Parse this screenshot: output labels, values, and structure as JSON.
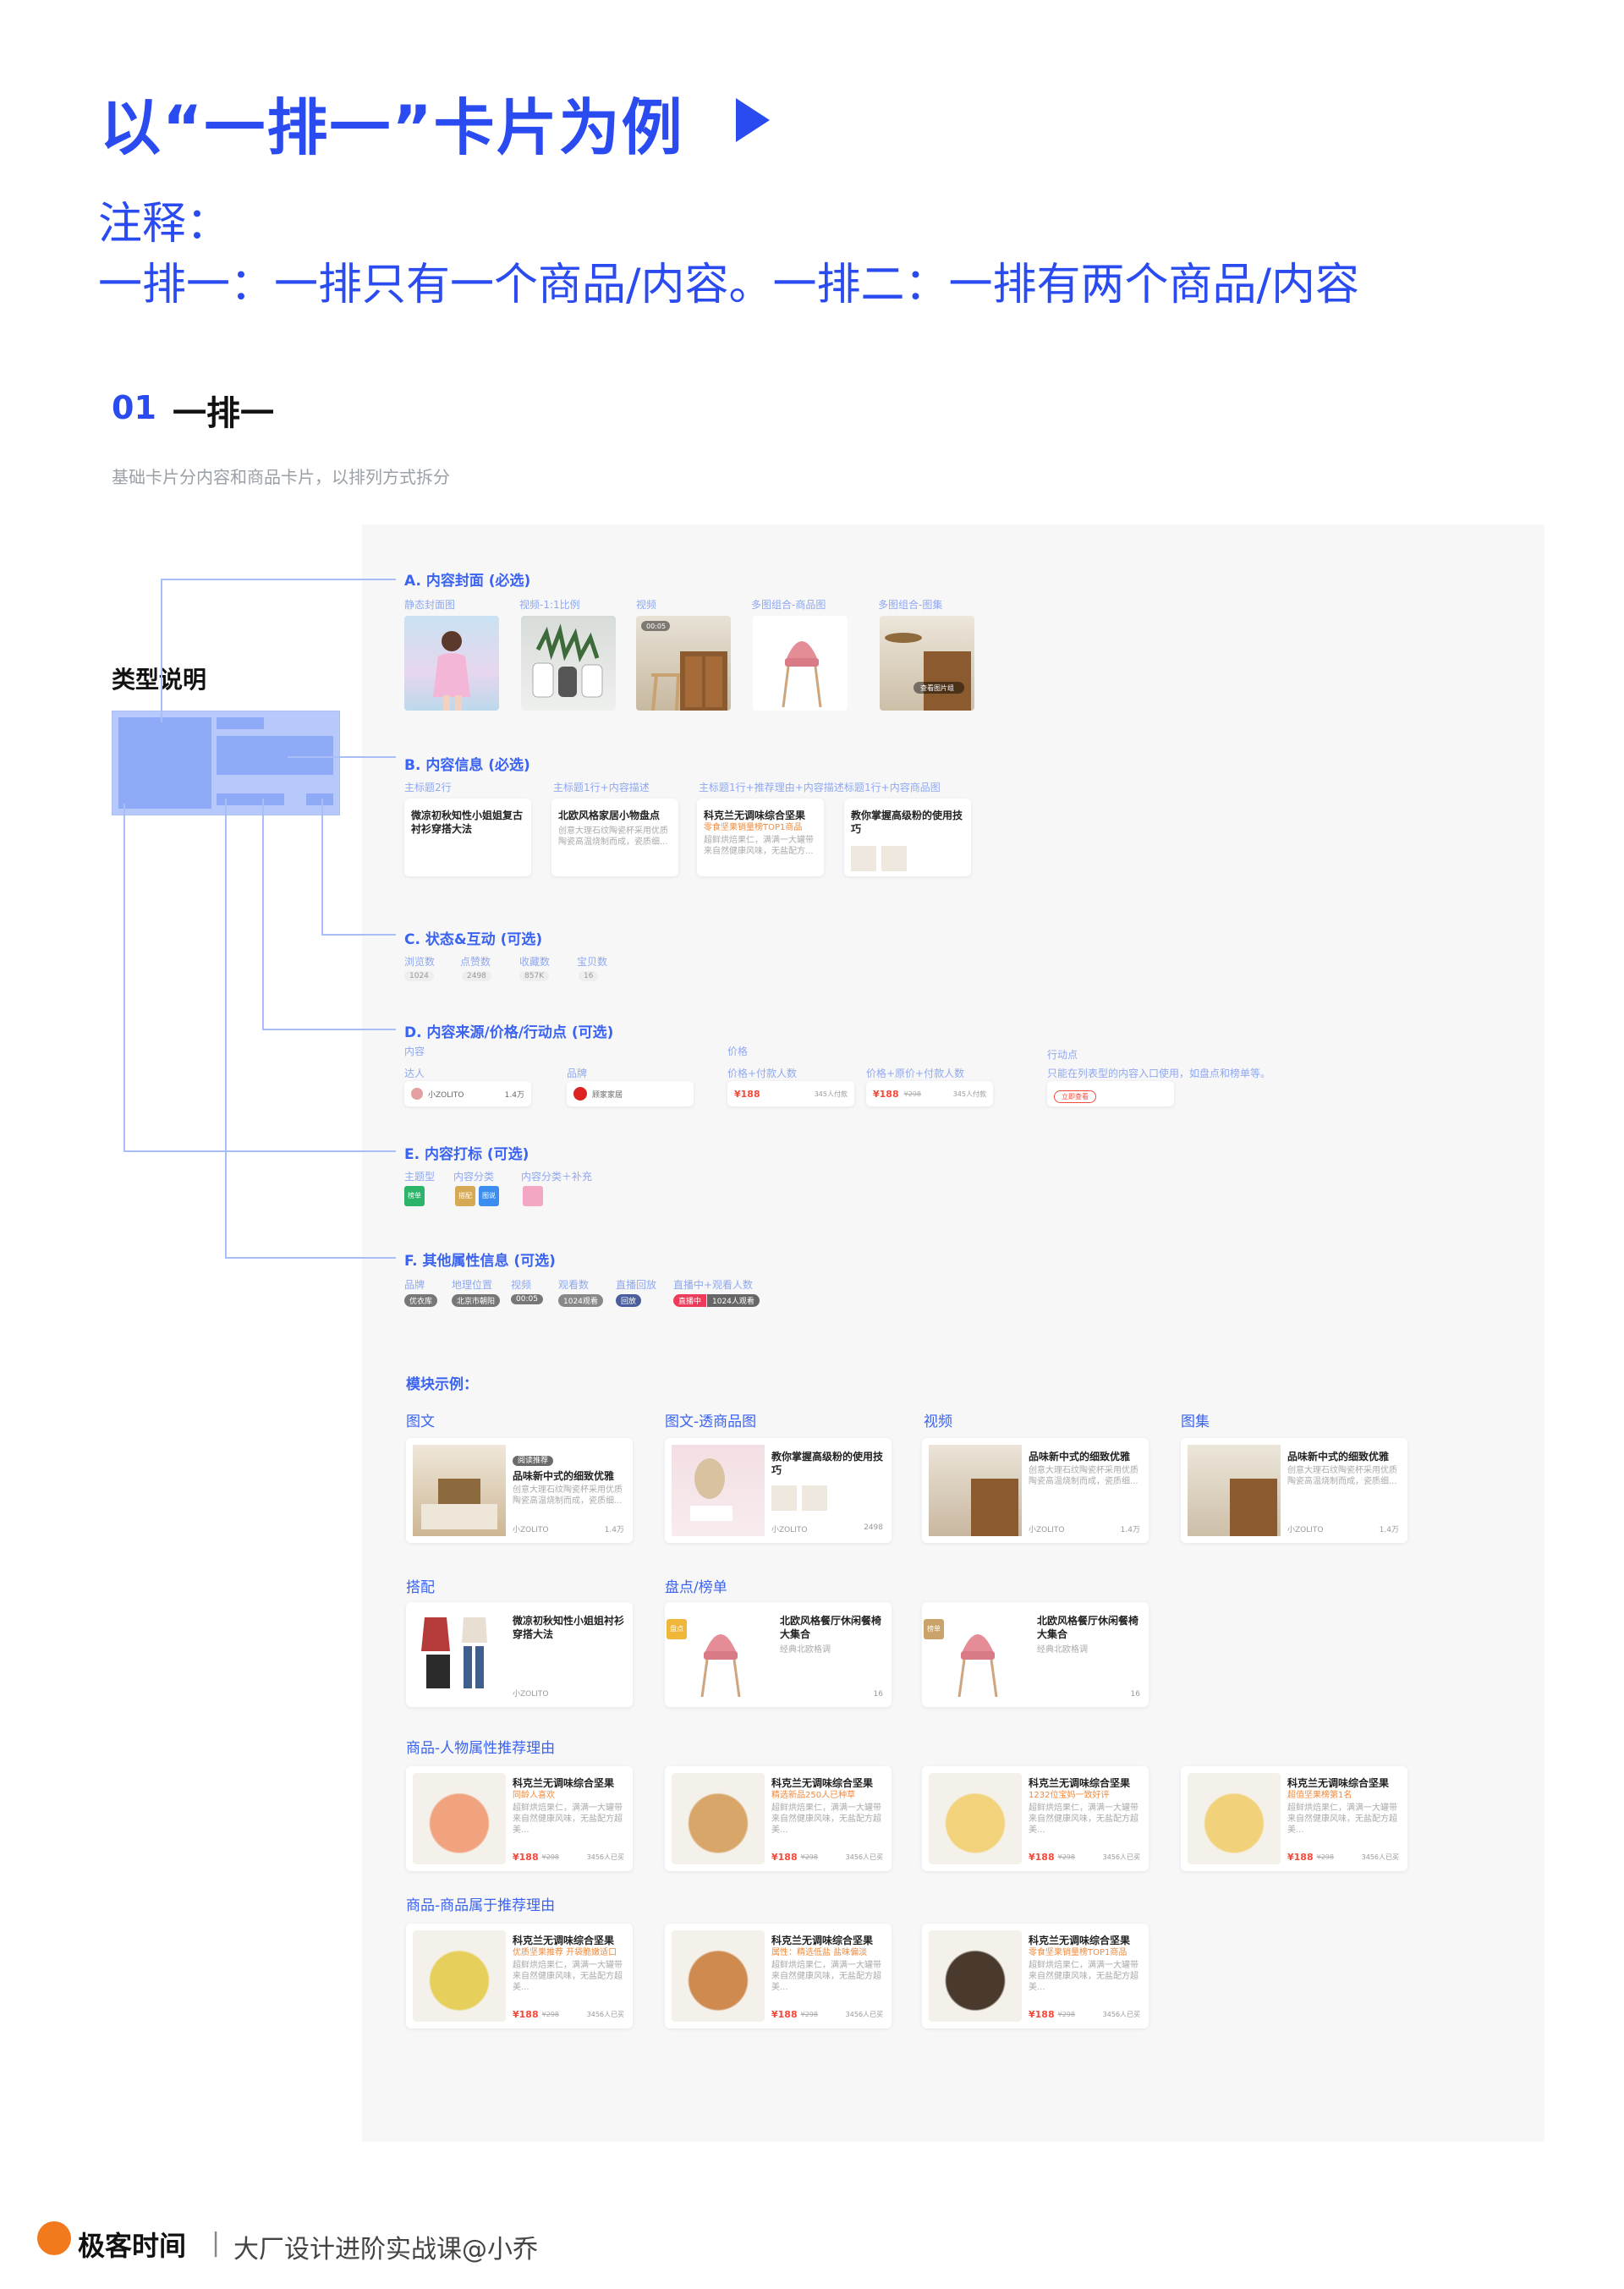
{
  "title": "以“一排一”卡片为例",
  "note_line1": "注释：",
  "note_line2": "一排一：一排只有一个商品/内容。一排二：一排有两个商品/内容",
  "section": {
    "num": "01",
    "title": "一排一",
    "desc": "基础卡片分内容和商品卡片，以排列方式拆分"
  },
  "type_label": "类型说明",
  "A": {
    "heading": "A. 内容封面 (必选)",
    "captions": [
      "静态封面图",
      "视频-1:1比例",
      "视频",
      "多图组合-商品图",
      "多图组合-图集"
    ],
    "badge": "查看图片组",
    "time": "00:05"
  },
  "B": {
    "heading": "B. 内容信息 (必选)",
    "captions": [
      "主标题2行",
      "主标题1行+内容描述",
      "主标题1行+推荐理由+内容描述",
      "标题1行+内容商品图"
    ],
    "cards": [
      {
        "title": "微凉初秋知性小姐姐复古衬衫穿搭大法",
        "desc": ""
      },
      {
        "title": "北欧风格家居小物盘点",
        "desc": "创意大理石纹陶瓷杯采用优质陶瓷高温烧制而成，瓷质细..."
      },
      {
        "title": "科克兰无调味综合坚果",
        "reason": "零食坚果销量榜TOP1商品",
        "desc": "超鲜烘焙果仁，满满一大罐带来自然健康风味，无盐配方..."
      },
      {
        "title": "教你掌握高级粉的使用技巧",
        "desc": ""
      }
    ]
  },
  "C": {
    "heading": "C. 状态&互动 (可选)",
    "captions": [
      "浏览数",
      "点赞数",
      "收藏数",
      "宝贝数"
    ],
    "values": [
      "1024",
      "2498",
      "857K",
      "16"
    ]
  },
  "D": {
    "heading": "D. 内容来源/价格/行动点 (可选)",
    "col1": "内容",
    "col2": "价格",
    "col3": "行动点",
    "captions": [
      "达人",
      "品牌",
      "价格+付款人数",
      "价格+原价+付款人数"
    ],
    "note": "只能在列表型的内容入口使用，如盘点和榜单等。",
    "author": "小ZOLITO",
    "views": "1.4万",
    "brand": "顾家家居",
    "price": "¥188",
    "orig": "¥298",
    "paid": "345人付款",
    "action": "立即查看"
  },
  "E": {
    "heading": "E. 内容打标 (可选)",
    "captions": [
      "主题型",
      "内容分类",
      "内容分类＋补充"
    ],
    "tags": [
      "榜单",
      "搭配",
      "图说",
      ""
    ]
  },
  "F": {
    "heading": "F. 其他属性信息 (可选)",
    "captions": [
      "品牌",
      "地理位置",
      "视频",
      "观看数",
      "直播回放",
      "直播中+观看人数"
    ],
    "chips": [
      "优衣库",
      "北京市朝阳",
      "00:05",
      "1024观看",
      "回放",
      "直播中",
      "1024人观看"
    ]
  },
  "modules": {
    "heading": "模块示例：",
    "row1": [
      {
        "label": "图文",
        "badge": "阅读推荐",
        "title": "品味新中式的细致优雅",
        "desc": "创意大理石纹陶瓷杯采用优质陶瓷高温烧制而成，瓷质细...",
        "author": "小ZOLITO",
        "stat": "1.4万"
      },
      {
        "label": "图文-透商品图",
        "title": "教你掌握高级粉的使用技巧",
        "author": "小ZOLITO",
        "stat": "2498"
      },
      {
        "label": "视频",
        "title": "品味新中式的细致优雅",
        "desc": "创意大理石纹陶瓷杯采用优质陶瓷高温烧制而成，瓷质细...",
        "author": "小ZOLITO",
        "stat": "1.4万"
      },
      {
        "label": "图集",
        "title": "品味新中式的细致优雅",
        "desc": "创意大理石纹陶瓷杯采用优质陶瓷高温烧制而成，瓷质细...",
        "author": "小ZOLITO",
        "stat": "1.4万"
      }
    ],
    "row2": [
      {
        "label": "搭配",
        "title": "微凉初秋知性小姐姐衬衫穿搭大法",
        "author": "小ZOLITO"
      },
      {
        "label": "盘点/榜单",
        "tag": "盘点",
        "title": "北欧风格餐厅休闲餐椅大集合",
        "desc": "经典北欧格调",
        "stat": "16"
      },
      {
        "label": "",
        "tag": "榜单",
        "title": "北欧风格餐厅休闲餐椅大集合",
        "desc": "经典北欧格调",
        "stat": "16"
      }
    ],
    "row3_label": "商品-人物属性推荐理由",
    "row3": [
      {
        "title": "科克兰无调味综合坚果",
        "reason": "同龄人喜欢",
        "desc": "超鲜烘焙果仁，满满一大罐带来自然健康风味，无盐配方超美...",
        "price": "¥188",
        "orig": "¥298",
        "paid": "3456人已买"
      },
      {
        "title": "科克兰无调味综合坚果",
        "reason": "精选新品250人已种草",
        "desc": "超鲜烘焙果仁，满满一大罐带来自然健康风味，无盐配方超美...",
        "price": "¥188",
        "orig": "¥298",
        "paid": "3456人已买"
      },
      {
        "title": "科克兰无调味综合坚果",
        "reason": "1232位宝妈一致好评",
        "desc": "超鲜烘焙果仁，满满一大罐带来自然健康风味，无盐配方超美...",
        "price": "¥188",
        "orig": "¥298",
        "paid": "3456人已买"
      },
      {
        "title": "科克兰无调味综合坚果",
        "reason": "超值坚果榜第1名",
        "desc": "超鲜烘焙果仁，满满一大罐带来自然健康风味，无盐配方超美...",
        "price": "¥188",
        "orig": "¥298",
        "paid": "3456人已买"
      }
    ],
    "row4_label": "商品-商品属于推荐理由",
    "row4": [
      {
        "title": "科克兰无调味综合坚果",
        "reason": "优质坚果推荐 开袋脆嫩适口",
        "desc": "超鲜烘焙果仁，满满一大罐带来自然健康风味，无盐配方超美...",
        "price": "¥188",
        "orig": "¥298",
        "paid": "3456人已买"
      },
      {
        "title": "科克兰无调味综合坚果",
        "reason": "属性：精选低盐 盐味偏淡",
        "desc": "超鲜烘焙果仁，满满一大罐带来自然健康风味，无盐配方超美...",
        "price": "¥188",
        "orig": "¥298",
        "paid": "3456人已买"
      },
      {
        "title": "科克兰无调味综合坚果",
        "reason": "零食坚果销量榜TOP1商品",
        "desc": "超鲜烘焙果仁，满满一大罐带来自然健康风味，无盐配方超美...",
        "price": "¥188",
        "orig": "¥298",
        "paid": "3456人已买"
      }
    ]
  },
  "footer": {
    "brand": "极客时间",
    "sep": "|",
    "text": "大厂设计进阶实战课@小乔"
  },
  "colors": {
    "accent": "#2a4bf0",
    "price": "#f24a3b",
    "panel": "#f7f7f8"
  }
}
